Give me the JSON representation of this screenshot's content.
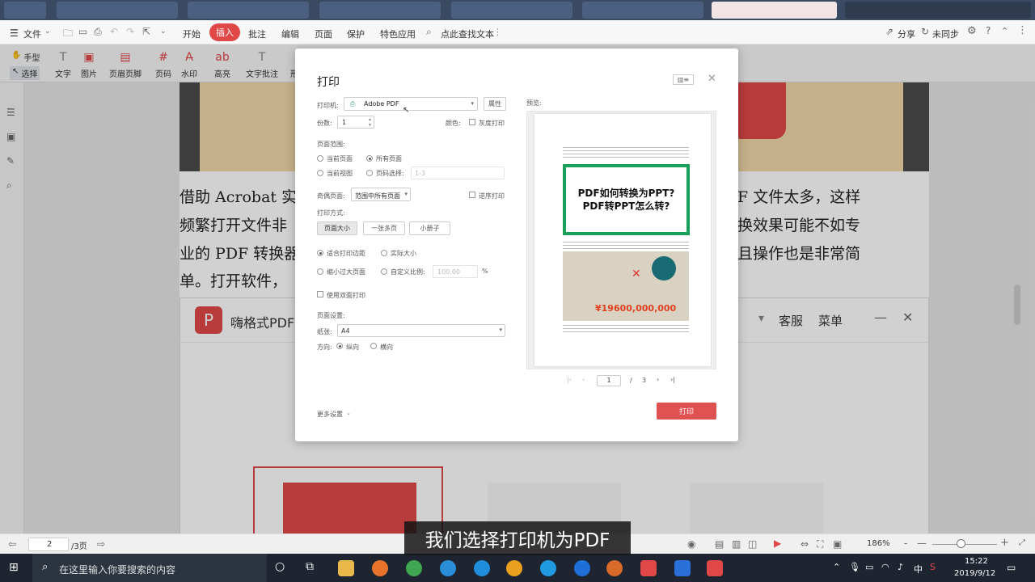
{
  "menubar": {
    "file": "文件",
    "items": [
      "开始",
      "插入",
      "批注",
      "编辑",
      "页面",
      "保护",
      "特色应用"
    ],
    "active_index": 1,
    "search_label": "点此查找文本",
    "share": "分享",
    "sync": "未同步"
  },
  "ribbon": {
    "hand": "手型",
    "select": "选择",
    "tools": [
      "文字",
      "图片",
      "页眉页脚",
      "页码",
      "水印",
      "高亮",
      "文字批注",
      "形"
    ]
  },
  "document": {
    "lines": [
      {
        "left": "借助 Acrobat 实",
        "right": "F 文件太多，这样"
      },
      {
        "left": "频繁打开文件非",
        "right": "换效果可能不如专"
      },
      {
        "left": "业的 PDF 转换器",
        "right": "且操作也是非常简"
      },
      {
        "left": "单。打开软件，",
        "right": ""
      }
    ],
    "app_title": "嗨格式PDF",
    "app_menu": [
      "客服",
      "菜单"
    ]
  },
  "print_dialog": {
    "title": "打印",
    "printer_label": "打印机:",
    "printer_value": "Adobe PDF",
    "properties": "属性",
    "copies_label": "份数:",
    "copies_value": "1",
    "color_label": "颜色:",
    "grayscale": "灰度打印",
    "range_label": "页面范围:",
    "current_page": "当前页面",
    "all_pages": "所有页面",
    "current_view": "当前视图",
    "page_select": "页码选择:",
    "page_select_placeholder": "1-3",
    "odd_even_label": "奇偶页面:",
    "odd_even_value": "范围中所有页面",
    "reverse": "逆序打印",
    "method_label": "打印方式:",
    "methods": [
      "页面大小",
      "一张多页",
      "小册子"
    ],
    "fit_margin": "适合打印边距",
    "actual_size": "实际大小",
    "shrink": "缩小过大页面",
    "custom_scale": "自定义比例:",
    "scale_value": "100.00",
    "percent": "%",
    "duplex": "使用双面打印",
    "page_setup": "页面设置:",
    "paper_label": "纸张:",
    "paper_value": "A4",
    "orientation_label": "方向:",
    "portrait": "纵向",
    "landscape": "横向",
    "more_settings": "更多设置",
    "preview_label": "预览:",
    "preview_page": "1",
    "preview_total": "3",
    "preview_sep": "/",
    "print_button": "打印",
    "preview_banner_line1": "PDF如何转换为PPT?",
    "preview_banner_line2": "PDF转PPT怎么转?",
    "preview_amount": "¥19600,000,000"
  },
  "statusbar": {
    "page": "2",
    "total": "/3页",
    "zoom": "186%"
  },
  "taskbar": {
    "search_placeholder": "在这里输入你要搜索的内容",
    "time": "15:22",
    "date": "2019/9/12",
    "ime": "中"
  },
  "subtitle": "我们选择打印机为PDF",
  "colors": {
    "accent": "#e04848",
    "print_button": "#e05252",
    "green_banner": "#1aa05a"
  }
}
